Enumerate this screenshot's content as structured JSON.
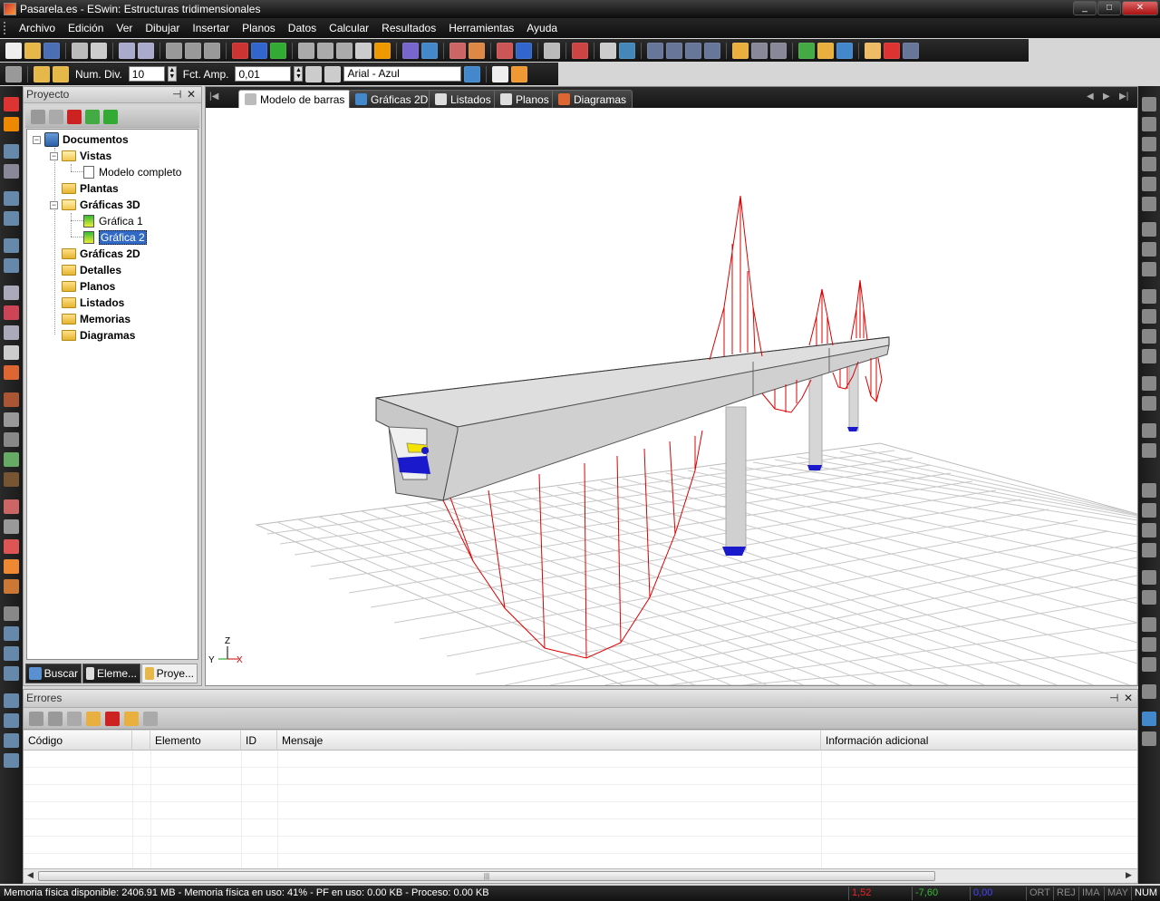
{
  "window": {
    "title": "Pasarela.es - ESwin: Estructuras tridimensionales",
    "minimize": "_",
    "maximize": "□",
    "close": "✕"
  },
  "menu": [
    "Archivo",
    "Edición",
    "Ver",
    "Dibujar",
    "Insertar",
    "Planos",
    "Datos",
    "Calcular",
    "Resultados",
    "Herramientas",
    "Ayuda"
  ],
  "toolbar2": {
    "num_div_label": "Num. Div.",
    "num_div_value": "10",
    "fct_amp_label": "Fct. Amp.",
    "fct_amp_value": "0,01",
    "font_value": "Arial - Azul"
  },
  "project_panel": {
    "title": "Proyecto",
    "pin": "ᵠ",
    "close": "✕",
    "tree": {
      "root": "Documentos",
      "vistas": "Vistas",
      "modelo_completo": "Modelo completo",
      "plantas": "Plantas",
      "graficas3d": "Gráficas 3D",
      "grafica1": "Gráfica 1",
      "grafica2": "Gráfica 2",
      "graficas2d": "Gráficas 2D",
      "detalles": "Detalles",
      "planos": "Planos",
      "listados": "Listados",
      "memorias": "Memorias",
      "diagramas": "Diagramas"
    },
    "bottom_tabs": [
      "Buscar",
      "Eleme...",
      "Proye..."
    ]
  },
  "view_tabs": [
    "Modelo de barras",
    "Gráficas 2D",
    "Listados",
    "Planos",
    "Diagramas"
  ],
  "axes": {
    "z": "Z",
    "y": "Y",
    "x": "X"
  },
  "errors_panel": {
    "title": "Errores",
    "columns": [
      "Código",
      "Elemento",
      "ID",
      "Mensaje",
      "Información adicional"
    ]
  },
  "statusbar": {
    "message": "Memoria física disponible: 2406.91 MB - Memoria física en uso: 41% - PF en uso: 0.00 KB - Proceso:  0.00 KB",
    "coord1": "1,52",
    "coord2": "-7,60",
    "coord3": "0,00",
    "ort": "ORT",
    "rej": "REJ",
    "ima": "IMA",
    "may": "MAY",
    "num": "NUM"
  },
  "colors": {
    "diagram": "#dd0000",
    "deck": "#d9d9d9",
    "support": "#1a1acc",
    "selection": "#3169c6"
  }
}
